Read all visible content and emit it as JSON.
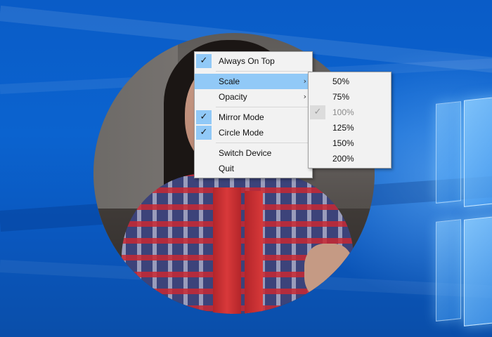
{
  "menu": {
    "items": [
      {
        "label": "Always On Top",
        "checked": true,
        "highlighted": false,
        "has_submenu": false
      },
      {
        "separator": true
      },
      {
        "label": "Scale",
        "checked": false,
        "highlighted": true,
        "has_submenu": true
      },
      {
        "label": "Opacity",
        "checked": false,
        "highlighted": false,
        "has_submenu": true
      },
      {
        "separator": true
      },
      {
        "label": "Mirror Mode",
        "checked": true,
        "highlighted": false,
        "has_submenu": false
      },
      {
        "label": "Circle Mode",
        "checked": true,
        "highlighted": false,
        "has_submenu": false
      },
      {
        "separator": true
      },
      {
        "label": "Switch Device",
        "checked": false,
        "highlighted": false,
        "has_submenu": false
      },
      {
        "label": "Quit",
        "checked": false,
        "highlighted": false,
        "has_submenu": false
      }
    ]
  },
  "scale_submenu": {
    "options": [
      {
        "label": "50%",
        "selected": false,
        "disabled": false
      },
      {
        "label": "75%",
        "selected": false,
        "disabled": false
      },
      {
        "label": "100%",
        "selected": true,
        "disabled": true
      },
      {
        "label": "125%",
        "selected": false,
        "disabled": false
      },
      {
        "label": "150%",
        "selected": false,
        "disabled": false
      },
      {
        "label": "200%",
        "selected": false,
        "disabled": false
      }
    ]
  },
  "icons": {
    "check": "check-icon",
    "submenu_arrow": "chevron-right-icon"
  },
  "colors": {
    "menu_background": "#f2f2f2",
    "highlight": "#91c9f7",
    "desktop_blue": "#0b63cf"
  }
}
